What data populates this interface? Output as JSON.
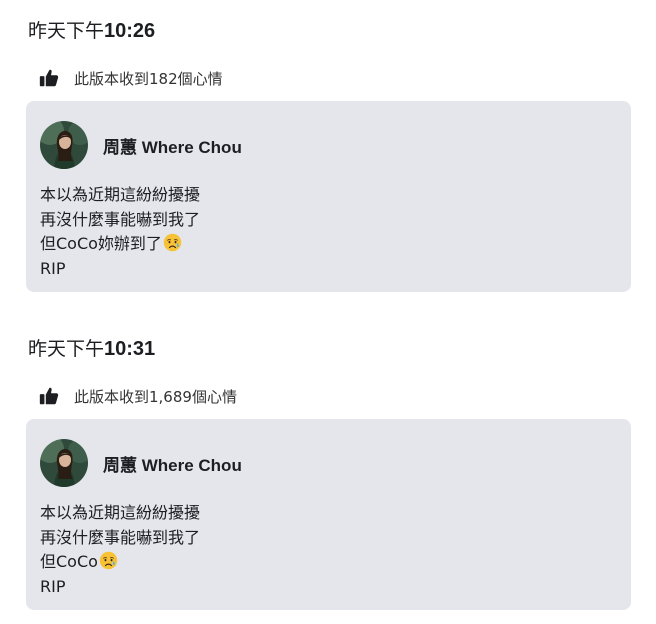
{
  "revisions": [
    {
      "timestamp_prefix": "昨天下午",
      "timestamp_time": "10:26",
      "reaction_text": "此版本收到182個心情",
      "author": "周蕙 Where Chou",
      "lines": [
        "本以為近期這紛紛擾擾",
        "再沒什麼事能嚇到我了",
        "但CoCo妳辦到了",
        "RIP"
      ],
      "emoji": "sad-but-relieved-face"
    },
    {
      "timestamp_prefix": "昨天下午",
      "timestamp_time": "10:31",
      "reaction_text": "此版本收到1,689個心情",
      "author": "周蕙 Where Chou",
      "lines": [
        "本以為近期這紛紛擾擾",
        "再沒什麼事能嚇到我了",
        "但CoCo",
        "RIP"
      ],
      "emoji": "sad-but-relieved-face"
    }
  ],
  "icons": {
    "reaction": "thumbs-up-icon",
    "avatar": "profile-photo"
  },
  "colors": {
    "card_background": "#e4e6eb",
    "text": "#1c1e21",
    "icon": "#1c1e21"
  }
}
